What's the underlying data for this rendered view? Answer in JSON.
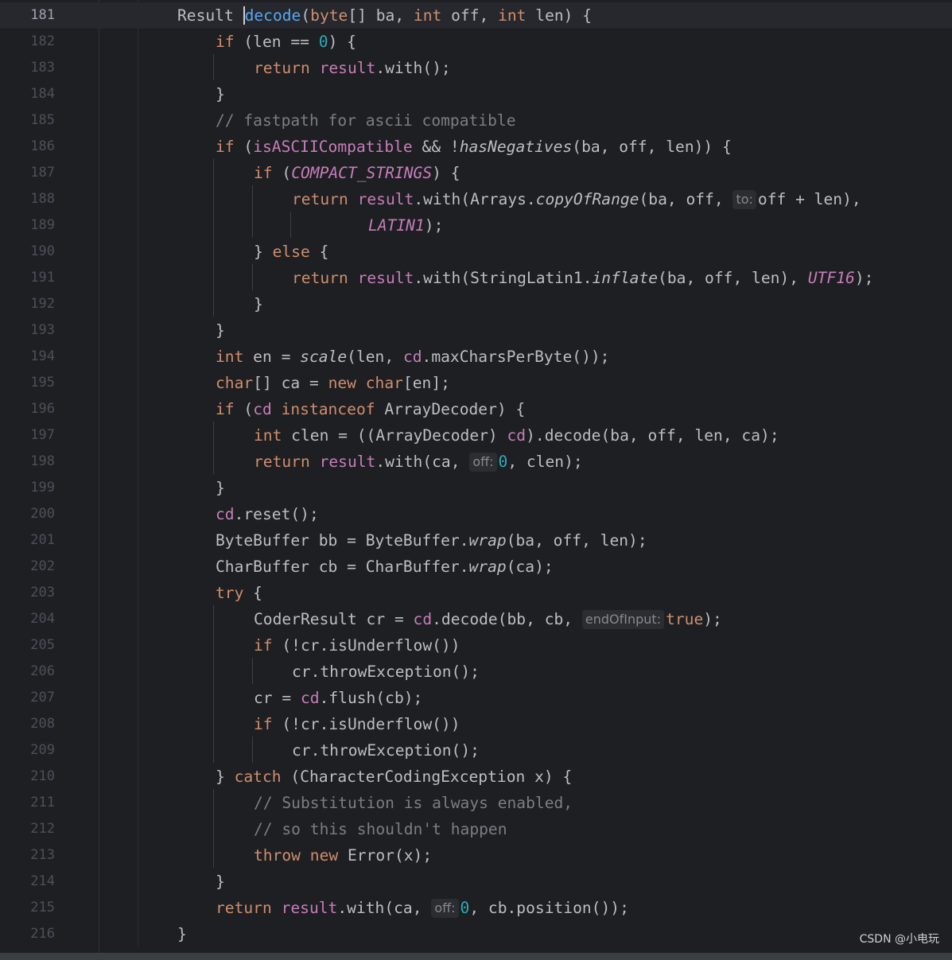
{
  "editor": {
    "current_line": 181,
    "line_numbers": [
      "181",
      "182",
      "183",
      "184",
      "185",
      "186",
      "187",
      "188",
      "189",
      "190",
      "191",
      "192",
      "193",
      "194",
      "195",
      "196",
      "197",
      "198",
      "199",
      "200",
      "201",
      "202",
      "203",
      "204",
      "205",
      "206",
      "207",
      "208",
      "209",
      "210",
      "211",
      "212",
      "213",
      "214",
      "215",
      "216"
    ]
  },
  "code": {
    "l181": [
      "Result ",
      "decode",
      "(",
      "byte",
      "[] ba, ",
      "int",
      " off, ",
      "int",
      " len) {"
    ],
    "l182": [
      "if",
      " (len == ",
      "0",
      ") {"
    ],
    "l183": [
      "return",
      " ",
      "result",
      ".with();"
    ],
    "l184": [
      "}"
    ],
    "l185": [
      "// fastpath for ascii compatible"
    ],
    "l186": [
      "if",
      " (",
      "isASCIICompatible",
      " && !",
      "hasNegatives",
      "(ba, off, len)) {"
    ],
    "l187": [
      "if",
      " (",
      "COMPACT_STRINGS",
      ") {"
    ],
    "l188": [
      "return",
      " ",
      "result",
      ".with(Arrays.",
      "copyOfRange",
      "(ba, off, ",
      "off + len),"
    ],
    "l189": [
      "LATIN1",
      ");"
    ],
    "l190": [
      "} ",
      "else",
      " {"
    ],
    "l191": [
      "return",
      " ",
      "result",
      ".with(StringLatin1.",
      "inflate",
      "(ba, off, len), ",
      "UTF16",
      ");"
    ],
    "l192": [
      "}"
    ],
    "l193": [
      "}"
    ],
    "l194": [
      "int",
      " en = ",
      "scale",
      "(len, ",
      "cd",
      ".maxCharsPerByte());"
    ],
    "l195": [
      "char",
      "[] ca = ",
      "new",
      " ",
      "char",
      "[en];"
    ],
    "l196": [
      "if",
      " (",
      "cd",
      " ",
      "instanceof",
      " ArrayDecoder) {"
    ],
    "l197": [
      "int",
      " clen = ((ArrayDecoder) ",
      "cd",
      ").decode(ba, off, len, ca);"
    ],
    "l198": [
      "return",
      " ",
      "result",
      ".with(ca, ",
      "0",
      ", clen);"
    ],
    "l199": [
      "}"
    ],
    "l200": [
      "cd",
      ".reset();"
    ],
    "l201": [
      "ByteBuffer bb = ByteBuffer.",
      "wrap",
      "(ba, off, len);"
    ],
    "l202": [
      "CharBuffer cb = CharBuffer.",
      "wrap",
      "(ca);"
    ],
    "l203": [
      "try",
      " {"
    ],
    "l204": [
      "CoderResult cr = ",
      "cd",
      ".decode(bb, cb, ",
      "true",
      ");"
    ],
    "l205": [
      "if",
      " (!cr.isUnderflow())"
    ],
    "l206": [
      "cr.throwException();"
    ],
    "l207": [
      "cr = ",
      "cd",
      ".flush(cb);"
    ],
    "l208": [
      "if",
      " (!cr.isUnderflow())"
    ],
    "l209": [
      "cr.throwException();"
    ],
    "l210": [
      "} ",
      "catch",
      " (CharacterCodingException x) {"
    ],
    "l211": [
      "// Substitution is always enabled,"
    ],
    "l212": [
      "// so this shouldn't happen"
    ],
    "l213": [
      "throw",
      " ",
      "new",
      " Error(x);"
    ],
    "l214": [
      "}"
    ],
    "l215": [
      "return",
      " ",
      "result",
      ".with(ca, ",
      "0",
      ", cb.position());"
    ],
    "l216": [
      "}"
    ]
  },
  "inlay_hints": {
    "l188": "to:",
    "l198": "off:",
    "l204": "endOfInput:",
    "l215": "off:"
  },
  "gutter_icons": {
    "l181": "lightbulb-icon"
  },
  "watermark": "CSDN @小电玩",
  "colors": {
    "background": "#1e1f22",
    "keyword": "#cf8e6d",
    "method_decl": "#56a8f5",
    "number": "#2aacb8",
    "comment": "#7a7e85",
    "field": "#c77dbb",
    "text": "#bcbec4",
    "line_number": "#4b5059",
    "bulb": "#f2c55c"
  }
}
